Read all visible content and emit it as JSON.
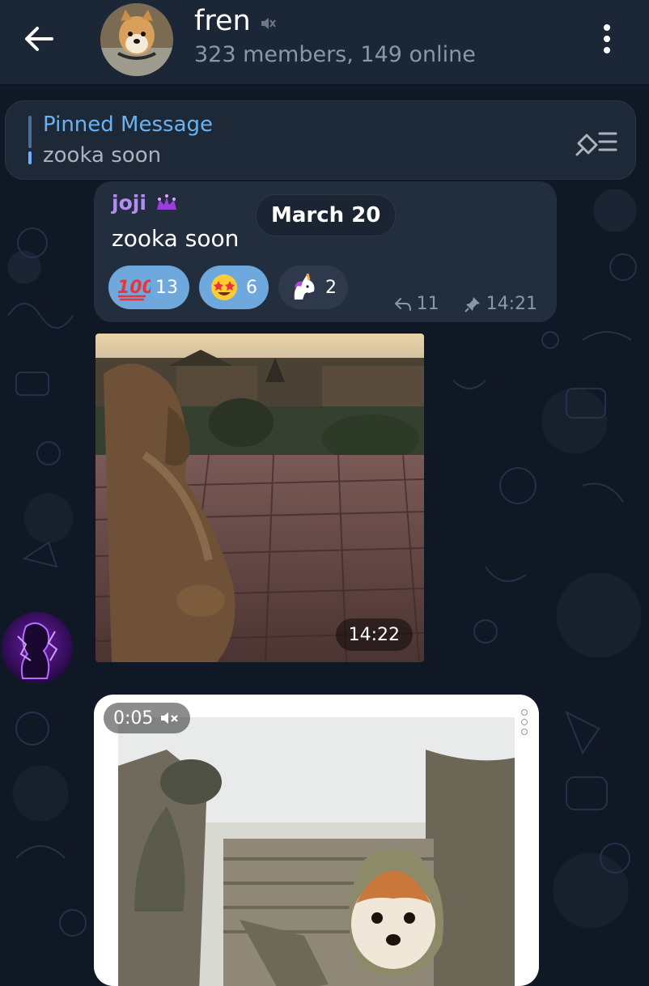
{
  "header": {
    "back_icon": "arrow-left-icon",
    "title": "fren",
    "muted_icon": "muted-speaker-icon",
    "subtitle": "323 members, 149 online",
    "menu_icon": "more-vertical-icon"
  },
  "pinned": {
    "label": "Pinned Message",
    "text": "zooka soon",
    "list_icon": "pin-list-icon"
  },
  "date_pill": "March 20",
  "message": {
    "sender": "joji",
    "sender_badge_icon": "crown-emoji-icon",
    "text": "zooka soon",
    "reactions": [
      {
        "emoji": "💯",
        "count": "13",
        "selected": true
      },
      {
        "emoji": "🤩",
        "count": "6",
        "selected": true
      },
      {
        "emoji": "🦄",
        "count": "2",
        "selected": false
      }
    ],
    "replies": "11",
    "time": "14:21"
  },
  "photo_message": {
    "time": "14:22"
  },
  "video_message": {
    "duration": "0:05",
    "muted_icon": "video-muted-icon"
  },
  "colors": {
    "background": "#0f1824",
    "header": "#1b2636",
    "bubble": "#222d3d",
    "accent": "#6ab2f2",
    "sender": "#b38df0",
    "reaction_selected": "#6fa8dc"
  }
}
